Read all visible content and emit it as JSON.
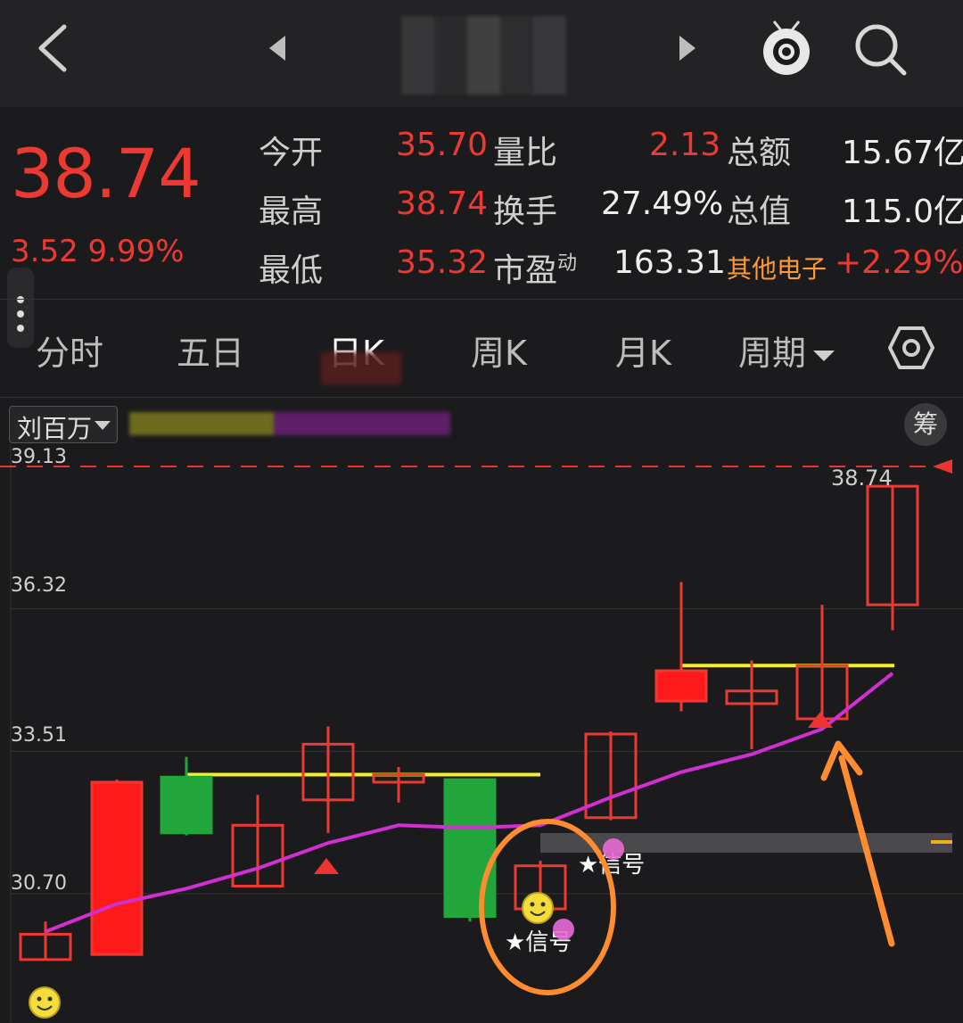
{
  "header": {
    "back_icon": "chevron-left-icon",
    "prev_icon": "caret-left-icon",
    "next_icon": "caret-right-icon",
    "assistant_icon": "robot-eye-icon",
    "search_icon": "search-icon"
  },
  "quote": {
    "price": "38.74",
    "change": "3.52",
    "change_pct": "9.99%",
    "open_label": "今开",
    "open": "35.70",
    "high_label": "最高",
    "high": "38.74",
    "low_label": "最低",
    "low": "35.32",
    "vol_ratio_label": "量比",
    "vol_ratio": "2.13",
    "turnover_label": "换手",
    "turnover": "27.49%",
    "pe_label": "市盈",
    "pe_sup": "动",
    "pe": "163.31",
    "amount_label": "总额",
    "amount": "15.67亿",
    "mktcap_label": "总值",
    "mktcap": "115.0亿",
    "sector": "其他电子",
    "sector_change": "+2.29%"
  },
  "tabs": [
    {
      "label": "分时"
    },
    {
      "label": "五日"
    },
    {
      "label": "日K"
    },
    {
      "label": "周K"
    },
    {
      "label": "月K"
    },
    {
      "label": "周期"
    }
  ],
  "indicator": {
    "label": "刘百万",
    "chip_label": "筹"
  },
  "colors": {
    "up": "#ec3a33",
    "down": "#22a63b",
    "ma": "#d22fd2",
    "support": "#f5ef2a",
    "accent": "#ff8c2e"
  },
  "chart_data": {
    "type": "candlestick",
    "y_ticks": [
      "39.13",
      "36.32",
      "33.51",
      "30.70"
    ],
    "last_price_label": "38.74",
    "candles": [
      {
        "o": 29.9,
        "c": 29.4,
        "h": 30.15,
        "l": 29.4,
        "color": "up"
      },
      {
        "o": 29.5,
        "c": 32.9,
        "h": 32.95,
        "l": 29.5,
        "color": "up-filled"
      },
      {
        "o": 33.0,
        "c": 31.9,
        "h": 33.4,
        "l": 31.85,
        "color": "down"
      },
      {
        "o": 30.85,
        "c": 32.05,
        "h": 32.65,
        "l": 30.85,
        "color": "up"
      },
      {
        "o": 32.55,
        "c": 33.65,
        "h": 34.0,
        "l": 31.9,
        "color": "up"
      },
      {
        "o": 33.05,
        "c": 32.9,
        "h": 33.2,
        "l": 32.5,
        "color": "up"
      },
      {
        "o": 32.95,
        "c": 30.25,
        "h": 32.95,
        "l": 30.15,
        "color": "down"
      },
      {
        "o": 30.4,
        "c": 31.25,
        "h": 31.35,
        "l": 30.3,
        "color": "up"
      },
      {
        "o": 33.85,
        "c": 32.2,
        "h": 33.9,
        "l": 32.15,
        "color": "up"
      },
      {
        "o": 35.1,
        "c": 34.5,
        "h": 36.85,
        "l": 34.3,
        "color": "up-filled"
      },
      {
        "o": 34.7,
        "c": 34.45,
        "h": 35.3,
        "l": 33.55,
        "color": "up"
      },
      {
        "o": 35.2,
        "c": 34.15,
        "h": 36.4,
        "l": 34.15,
        "color": "up"
      },
      {
        "o": 36.4,
        "c": 38.74,
        "h": 38.74,
        "l": 35.9,
        "color": "up"
      }
    ],
    "ma_line": [
      29.95,
      30.5,
      30.8,
      31.2,
      31.7,
      32.05,
      32.0,
      32.05,
      32.6,
      33.1,
      33.45,
      33.95,
      35.05
    ],
    "support_lines": [
      33.05,
      35.2
    ],
    "signal_labels": [
      "★信号",
      "★信号"
    ]
  }
}
